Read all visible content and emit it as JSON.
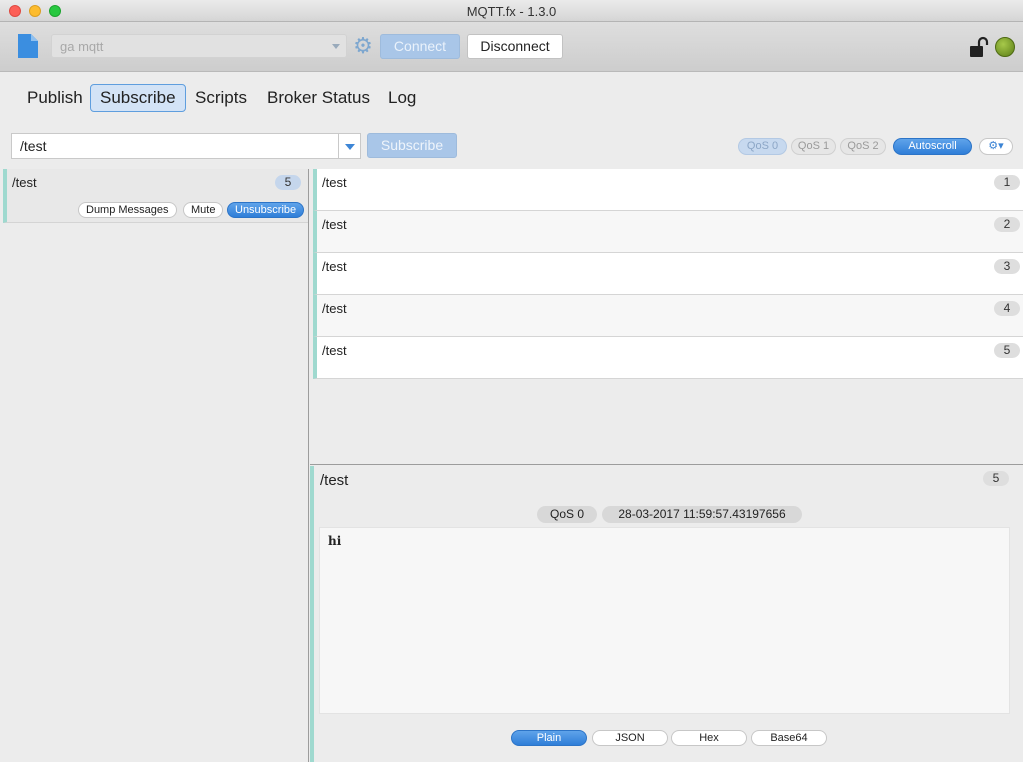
{
  "window": {
    "title": "MQTT.fx - 1.3.0"
  },
  "toolbar": {
    "profile_value": "ga mqtt",
    "connect_label": "Connect",
    "disconnect_label": "Disconnect",
    "status_color": "#6b8e23"
  },
  "tabs": [
    {
      "label": "Publish",
      "active": false
    },
    {
      "label": "Subscribe",
      "active": true
    },
    {
      "label": "Scripts",
      "active": false
    },
    {
      "label": "Broker Status",
      "active": false
    },
    {
      "label": "Log",
      "active": false
    }
  ],
  "subscribe_bar": {
    "topic_value": "/test",
    "subscribe_label": "Subscribe",
    "qos_options": [
      "QoS 0",
      "QoS 1",
      "QoS 2"
    ],
    "selected_qos": "QoS 0",
    "autoscroll_label": "Autoscroll"
  },
  "subscriptions": [
    {
      "topic": "/test",
      "count": "5",
      "dump_label": "Dump Messages",
      "mute_label": "Mute",
      "unsubscribe_label": "Unsubscribe"
    }
  ],
  "messages": [
    {
      "topic": "/test",
      "num": "1"
    },
    {
      "topic": "/test",
      "num": "2"
    },
    {
      "topic": "/test",
      "num": "3"
    },
    {
      "topic": "/test",
      "num": "4"
    },
    {
      "topic": "/test",
      "num": "5"
    }
  ],
  "detail": {
    "topic": "/test",
    "num": "5",
    "qos": "QoS 0",
    "timestamp": "28-03-2017  11:59:57.43197656",
    "payload": "hi",
    "formats": [
      "Plain",
      "JSON",
      "Hex",
      "Base64"
    ],
    "selected_format": "Plain"
  },
  "colors": {
    "accent": "#2f7ed8",
    "row_marker": "#9fd9cf"
  }
}
